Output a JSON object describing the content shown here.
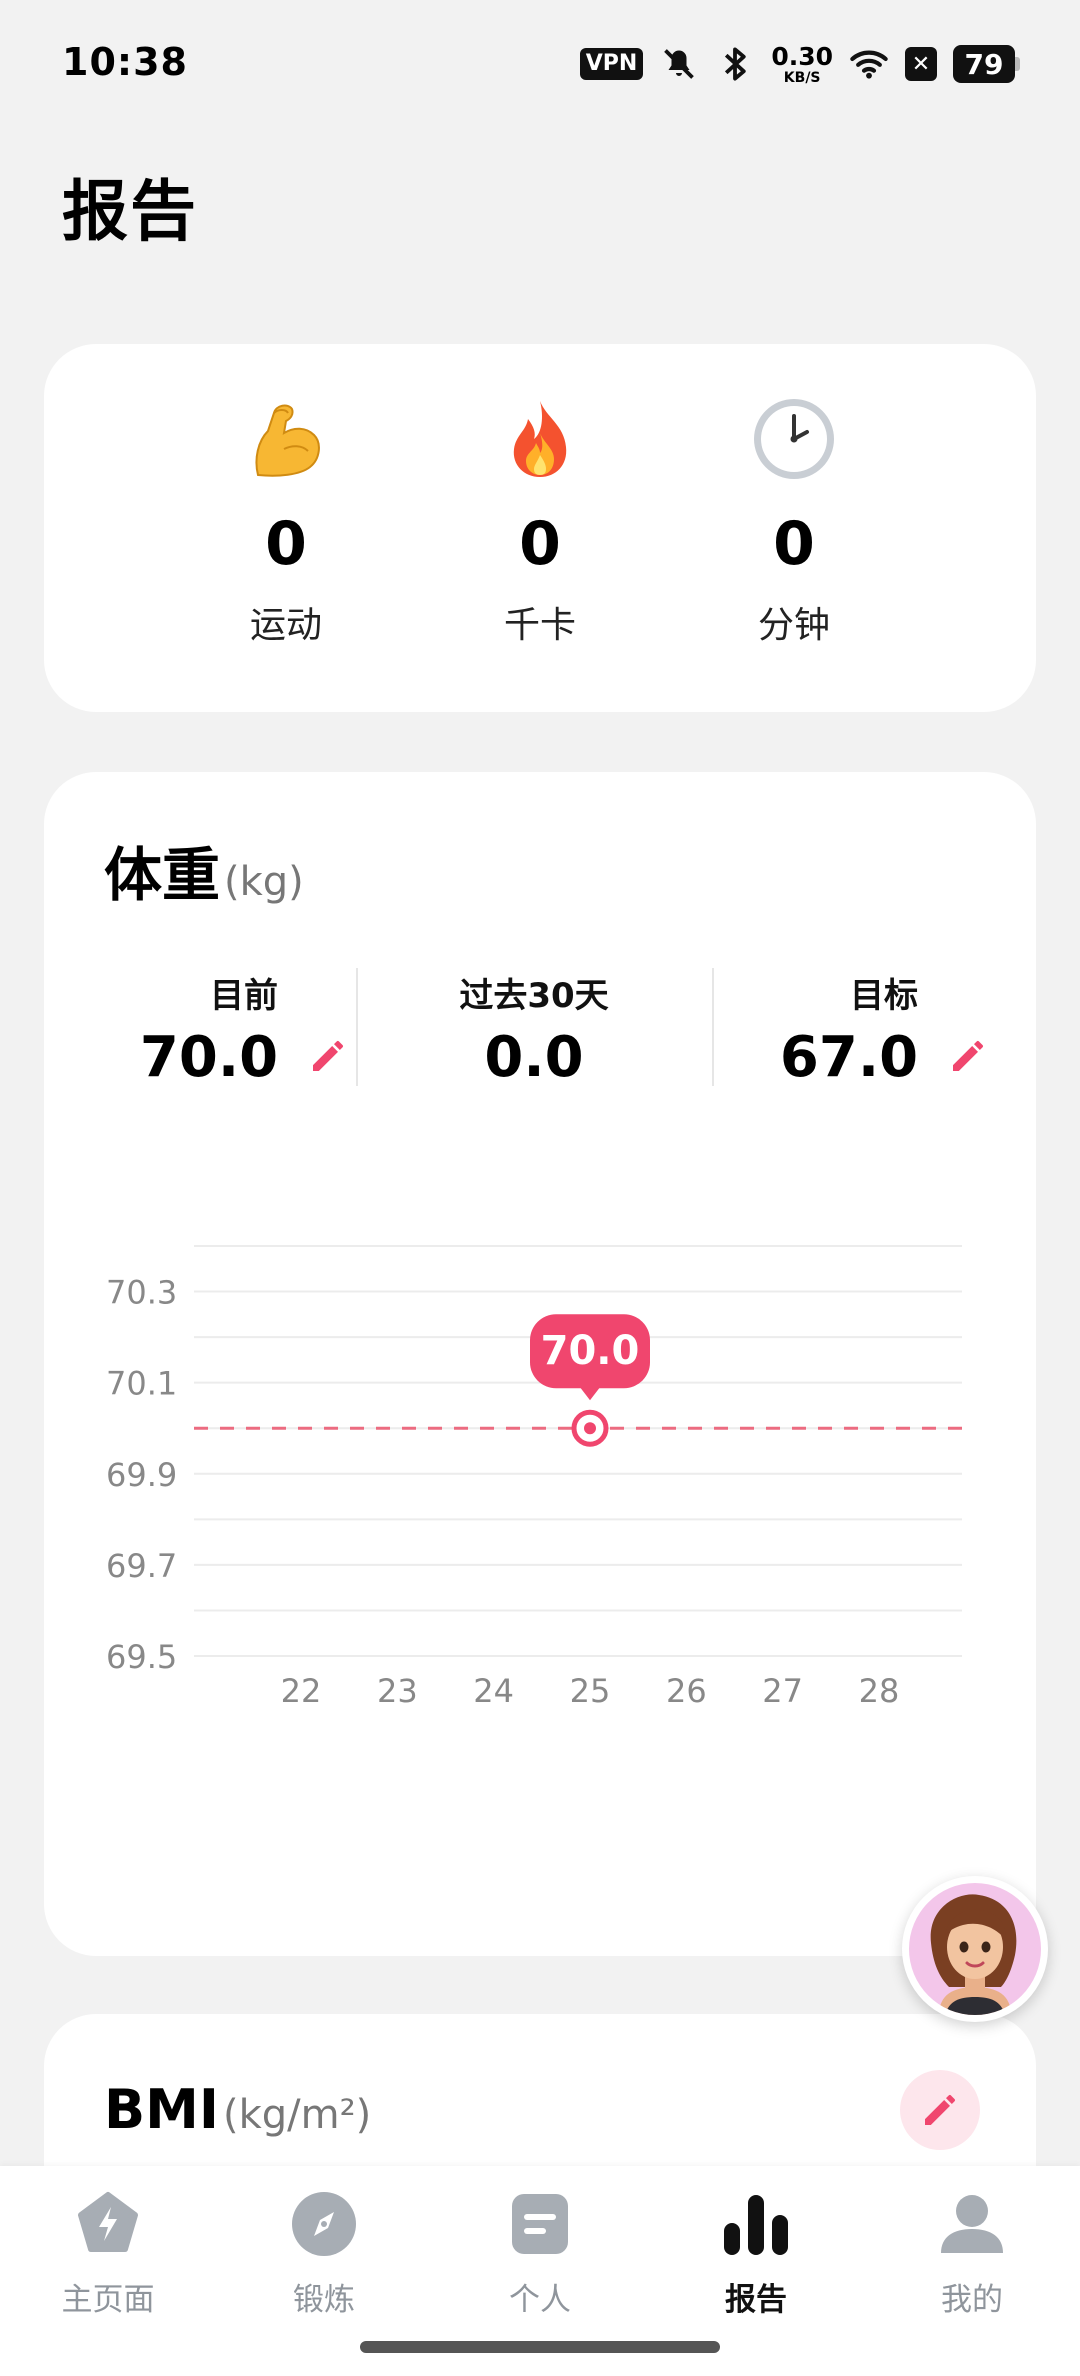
{
  "status_bar": {
    "time": "10:38",
    "vpn": "VPN",
    "speed_value": "0.30",
    "speed_unit": "KB/S",
    "battery": "79",
    "icons": [
      "mute-icon",
      "bluetooth-icon",
      "wifi-icon",
      "x-icon",
      "battery-icon"
    ]
  },
  "page_title": "报告",
  "summary": [
    {
      "icon": "flexed-biceps-emoji",
      "value": "0",
      "label": "运动"
    },
    {
      "icon": "fire-emoji",
      "value": "0",
      "label": "千卡"
    },
    {
      "icon": "clock-emoji",
      "value": "0",
      "label": "分钟"
    }
  ],
  "weight": {
    "title": "体重",
    "unit": "(kg)",
    "current_label": "目前",
    "current_value": "70.0",
    "past_label": "过去30天",
    "past_value": "0.0",
    "goal_label": "目标",
    "goal_value": "67.0"
  },
  "chart_data": {
    "type": "line",
    "x": [
      22,
      23,
      24,
      25,
      26,
      27,
      28
    ],
    "x_tick_labels": [
      "22",
      "23",
      "24",
      "25",
      "26",
      "27",
      "28"
    ],
    "y_tick_labels": [
      "70.3",
      "70.1",
      "69.9",
      "69.7",
      "69.5"
    ],
    "ylim": [
      69.5,
      70.4
    ],
    "series": [
      {
        "points": [
          {
            "x": 25,
            "y": 70.0
          }
        ]
      }
    ],
    "reference_line": 70.0,
    "highlight_label": "70.0",
    "grid": true,
    "colors": {
      "accent": "#f0466e",
      "dashed_line": "#ec6b80"
    }
  },
  "bmi": {
    "title": "BMI",
    "unit": "(kg/m²)"
  },
  "bottom_nav": [
    {
      "label": "主页面",
      "icon": "lightning-icon",
      "active": false
    },
    {
      "label": "锻炼",
      "icon": "compass-icon",
      "active": false
    },
    {
      "label": "个人",
      "icon": "note-icon",
      "active": false
    },
    {
      "label": "报告",
      "icon": "bar-chart-icon",
      "active": true
    },
    {
      "label": "我的",
      "icon": "person-icon",
      "active": false
    }
  ],
  "colors": {
    "accent": "#f0466e",
    "background": "#f2f2f2",
    "nav_inactive": "#8f959c"
  }
}
